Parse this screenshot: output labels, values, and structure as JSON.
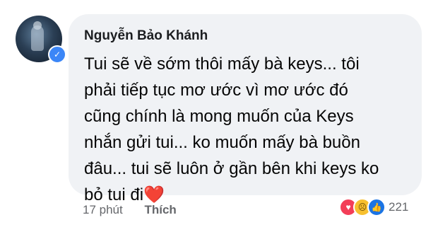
{
  "comment": {
    "author": "Nguyễn Bảo Khánh",
    "lines": [
      "Tui sẽ về sớm thôi mấy bà keys... tôi",
      "phải tiếp tục mơ ước vì mơ ước đó",
      "cũng chính là mong muốn của Keys",
      "nhắn gửi tui... ko muốn mấy bà buồn",
      "đâu... tui sẽ luôn ở gần bên khi keys ko",
      "bỏ tui đi"
    ],
    "emoji": "❤️"
  },
  "footer": {
    "time": "17 phút",
    "like_label": "Thích"
  },
  "reactions": {
    "icons": [
      "heart-reaction",
      "sad-reaction",
      "like-reaction"
    ],
    "count": "221"
  },
  "colors": {
    "bubble": "#f0f2f5",
    "verified": "#3b86f7",
    "love": "#f33e58",
    "like": "#1b74e4"
  }
}
